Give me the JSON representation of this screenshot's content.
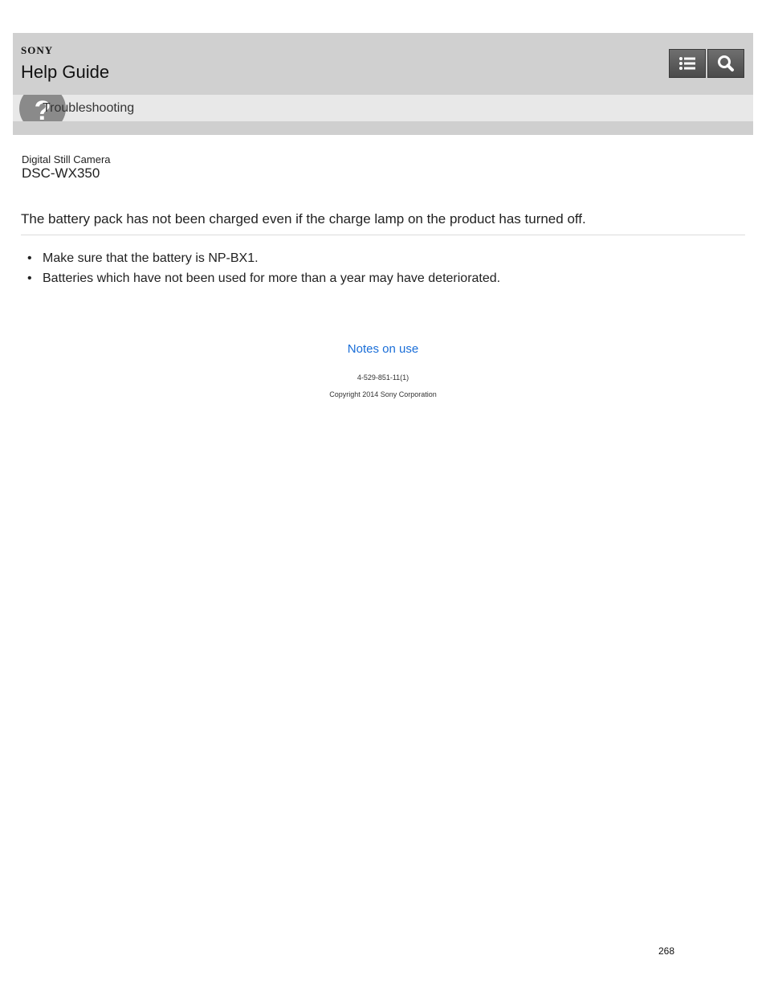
{
  "header": {
    "brand": "SONY",
    "title": "Help Guide",
    "toc_button_icon": "list-icon",
    "search_button_icon": "search-icon"
  },
  "breadcrumb": {
    "icon": "question-mark-icon",
    "label": "Troubleshooting"
  },
  "product": {
    "type": "Digital Still Camera",
    "model": "DSC-WX350"
  },
  "article": {
    "heading": "The battery pack has not been charged even if the charge lamp on the product has turned off.",
    "bullets": [
      "Make sure that the battery is NP-BX1.",
      "Batteries which have not been used for more than a year may have deteriorated."
    ]
  },
  "footer": {
    "link": "Notes on use",
    "doc_number": "4-529-851-11(1)",
    "copyright": "Copyright 2014 Sony Corporation"
  },
  "page_number": "268",
  "colors": {
    "header_bg": "#d0d0d0",
    "subbar_bg": "#e8e8e8",
    "link": "#1a6ed8"
  }
}
